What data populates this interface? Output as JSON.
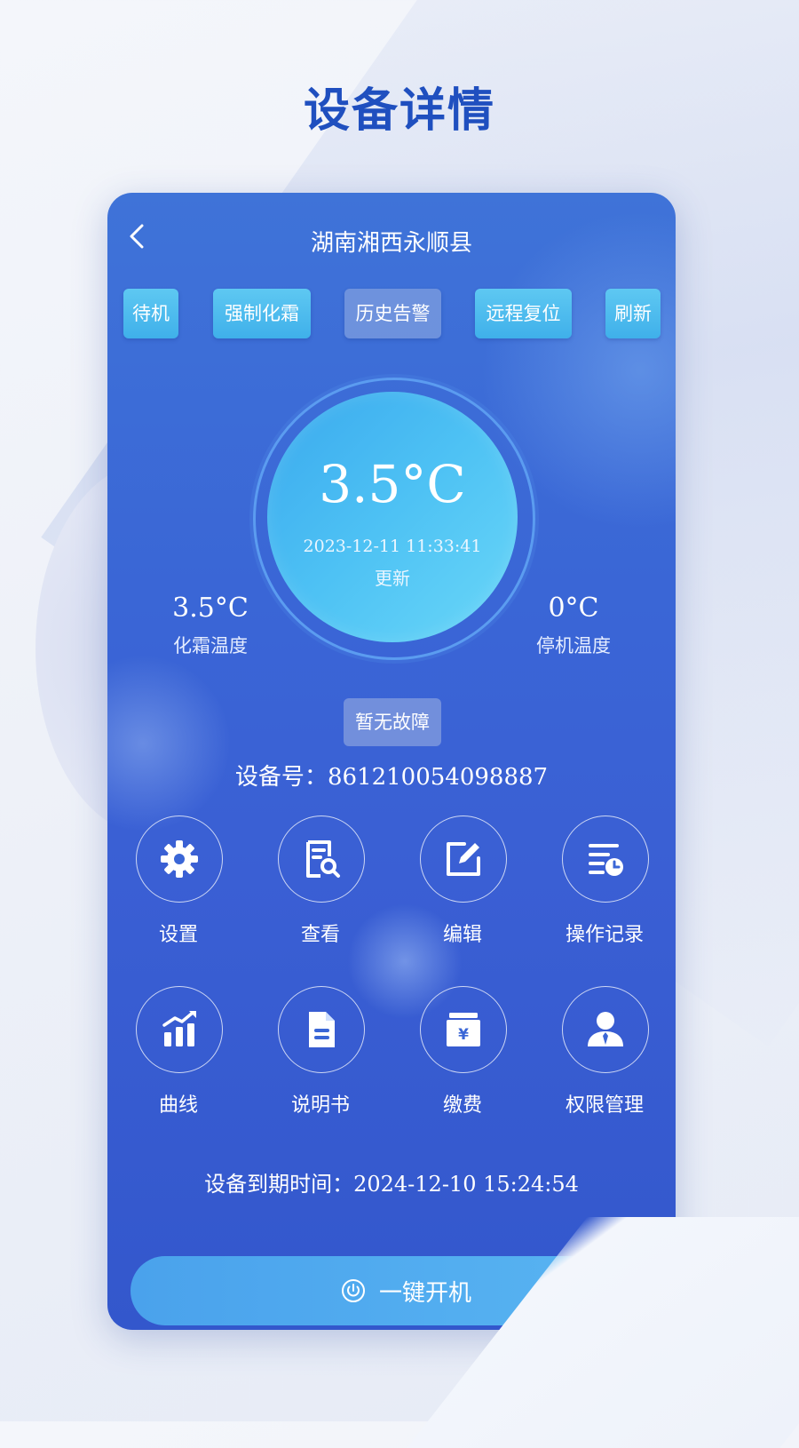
{
  "headline": "设备详情",
  "nav": {
    "title": "湖南湘西永顺县",
    "back_icon": "chevron-left-icon"
  },
  "actions": [
    {
      "label": "待机"
    },
    {
      "label": "强制化霜"
    },
    {
      "label": "历史告警"
    },
    {
      "label": "远程复位"
    },
    {
      "label": "刷新"
    }
  ],
  "dial": {
    "temperature": "3.5°C",
    "updated_time": "2023-12-11 11:33:41",
    "updated_label": "更新"
  },
  "defrost": {
    "value": "3.5°C",
    "label": "化霜温度"
  },
  "stop": {
    "value": "0°C",
    "label": "停机温度"
  },
  "fault_status": "暂无故障",
  "device": {
    "label": "设备号：",
    "number": "861210054098887"
  },
  "menu": [
    {
      "label": "设置",
      "icon": "gear-icon"
    },
    {
      "label": "查看",
      "icon": "view-document-icon"
    },
    {
      "label": "编辑",
      "icon": "edit-icon"
    },
    {
      "label": "操作记录",
      "icon": "operation-log-icon"
    },
    {
      "label": "曲线",
      "icon": "chart-icon"
    },
    {
      "label": "说明书",
      "icon": "manual-icon"
    },
    {
      "label": "缴费",
      "icon": "payment-icon"
    },
    {
      "label": "权限管理",
      "icon": "user-permission-icon"
    }
  ],
  "expire": {
    "label": "设备到期时间：",
    "time": "2024-12-10 15:24:54"
  },
  "power_button": {
    "label": "一键开机",
    "icon": "power-icon"
  },
  "colors": {
    "headline": "#1f4fbf",
    "card_bg": "#3a66d6",
    "action_button": "#4ebcef",
    "dial": "#4ec2f4"
  }
}
